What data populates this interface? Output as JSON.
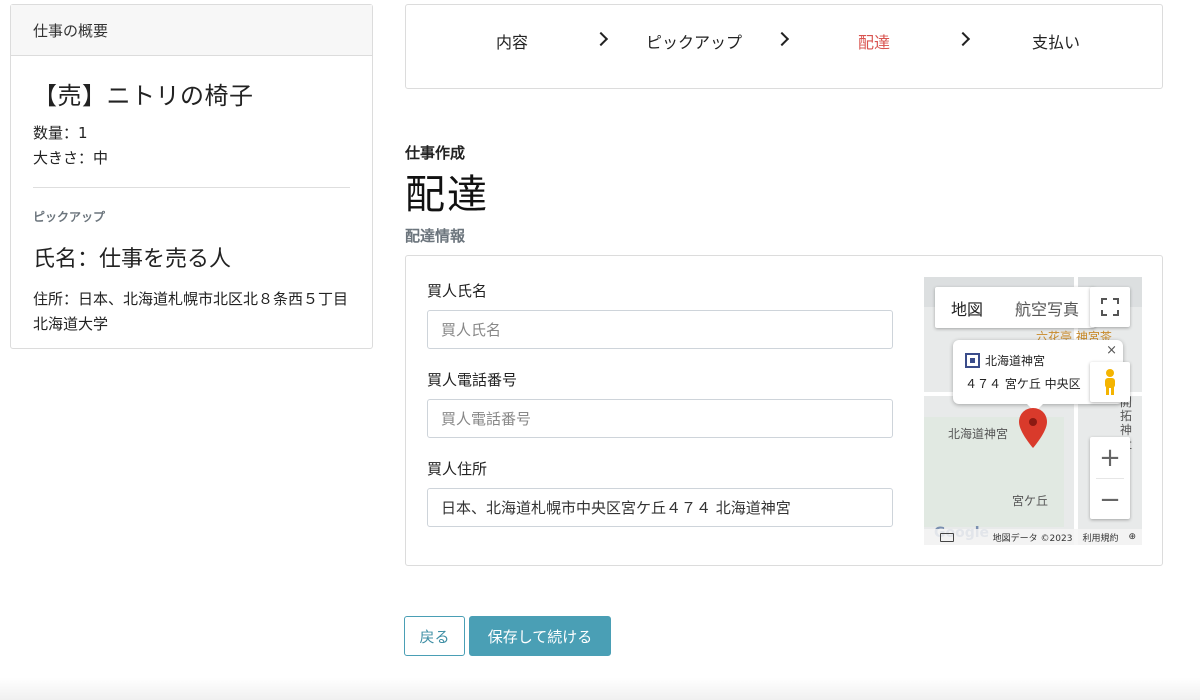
{
  "summary": {
    "header": "仕事の概要",
    "item_title": "【売】ニトリの椅子",
    "quantity": "数量：1",
    "size": "大きさ：中",
    "pickup_section": "ピックアップ",
    "pickup_name": "氏名：仕事を売る人",
    "pickup_address": "住所：日本、北海道札幌市北区北８条西５丁目 北海道大学"
  },
  "steps": {
    "items": [
      {
        "label": "内容",
        "active": false
      },
      {
        "label": "ピックアップ",
        "active": false
      },
      {
        "label": "配達",
        "active": true
      },
      {
        "label": "支払い",
        "active": false
      }
    ],
    "active_color": "#d9534f"
  },
  "heading": {
    "subtitle": "仕事作成",
    "title": "配達",
    "section_label": "配達情報"
  },
  "form": {
    "buyer_name": {
      "label": "買人氏名",
      "placeholder": "買人氏名",
      "value": ""
    },
    "buyer_phone": {
      "label": "買人電話番号",
      "placeholder": "買人電話番号",
      "value": ""
    },
    "buyer_address": {
      "label": "買人住所",
      "placeholder": "買人住所",
      "value": "日本、北海道札幌市中央区宮ケ丘４７４ 北海道神宮"
    }
  },
  "map": {
    "type_map": "地図",
    "type_satellite": "航空写真",
    "info_title": "北海道神宮",
    "info_address": "４７４ 宮ケ丘 中央区",
    "close": "×",
    "label_shrine": "北海道神宮",
    "label_area": "宮ケ丘",
    "label_poi": "六花亭 神宮茶",
    "label_right1": "開拓神社",
    "zoom_in": "+",
    "zoom_out": "−",
    "logo": "Google",
    "attribution": "地図データ ©2023",
    "terms": "利用規約"
  },
  "buttons": {
    "back": "戻る",
    "save": "保存して続ける"
  },
  "colors": {
    "primary": "#4a9fb5",
    "marker": "#d93a2b"
  }
}
